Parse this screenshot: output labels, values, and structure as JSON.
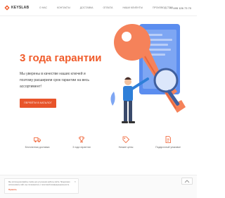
{
  "header": {
    "logo_text": "KEYSLAB",
    "nav": [
      "О нас",
      "Контакты",
      "Доставка",
      "Оплата",
      "Наши клиенты",
      "Производство"
    ],
    "phone": "+7 495 126 73 70"
  },
  "hero": {
    "title": "3 года гарантии",
    "text": "Мы уверены в качестве наших ключей и поэтому расширили срок гарантии на весь ассортимент!",
    "cta_label": "Перейти в каталог"
  },
  "features": [
    {
      "icon": "truck-icon",
      "label": "Бесплатная доставка"
    },
    {
      "icon": "trophy-icon",
      "label": "3 года гарантии"
    },
    {
      "icon": "tag-icon",
      "label": "Низкие цены"
    },
    {
      "icon": "document-icon",
      "label": "Подарочный упаковке"
    }
  ],
  "cookie": {
    "text": "Мы используем файлы cookie для улучшения работы сайта. Продолжая использовать сайт, вы соглашаетесь с политикой конфиденциальности.",
    "accept_label": "Принять",
    "close_label": "×"
  },
  "colors": {
    "accent": "#f05b2a",
    "button": "#e8542a",
    "illustration_blue": "#5b8def",
    "illustration_orange": "#f5825a"
  }
}
